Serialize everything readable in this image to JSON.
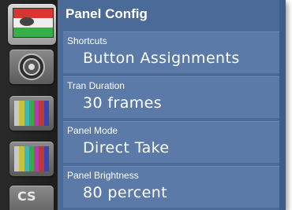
{
  "panel": {
    "title": "Panel Config"
  },
  "settings": [
    {
      "label": "Shortcuts",
      "value": "Button Assignments"
    },
    {
      "label": "Tran Duration",
      "value": "30 frames"
    },
    {
      "label": "Panel Mode",
      "value": "Direct Take"
    },
    {
      "label": "Panel Brightness",
      "value": "80 percent"
    }
  ],
  "sidebar": {
    "tiles": [
      {
        "icon": "preview-program-icon",
        "active": true
      },
      {
        "icon": "camera-lens-icon"
      },
      {
        "icon": "color-bars-icon"
      },
      {
        "icon": "color-bars-icon"
      },
      {
        "icon": "cs-settings-icon",
        "text": "CS"
      }
    ]
  },
  "colors": {
    "background": "#4a6a98",
    "row": "#5b7aa8",
    "sidebar": "#222222"
  }
}
